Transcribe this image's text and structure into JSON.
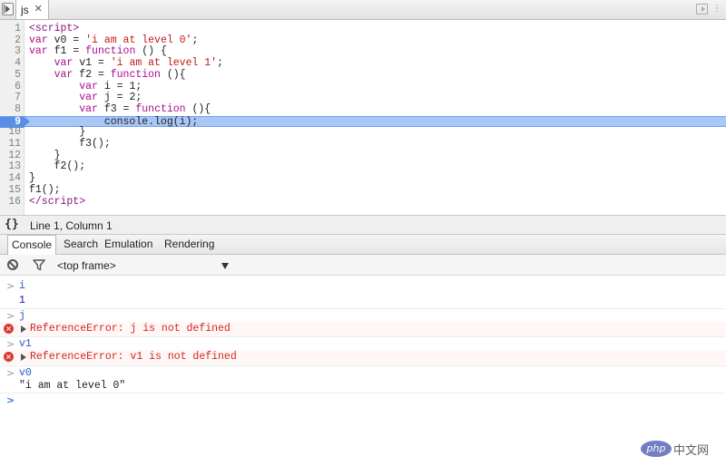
{
  "sources": {
    "tab": {
      "label": "js",
      "close_glyph": "✕"
    },
    "more_glyph": "⋮",
    "lines": [
      {
        "n": "1",
        "html": "<span class=\"t\">&lt;script&gt;</span>"
      },
      {
        "n": "2",
        "html": "<span class=\"k\">var</span> v0 = <span class=\"s\">'i am at level 0'</span>;"
      },
      {
        "n": "3",
        "html": "<span class=\"k\">var</span> f1 = <span class=\"k\">function</span> () {"
      },
      {
        "n": "4",
        "html": "    <span class=\"k\">var</span> v1 = <span class=\"s\">'i am at level 1'</span>;"
      },
      {
        "n": "5",
        "html": "    <span class=\"k\">var</span> f2 = <span class=\"k\">function</span> (){"
      },
      {
        "n": "6",
        "html": "        <span class=\"k\">var</span> i = 1;"
      },
      {
        "n": "7",
        "html": "        <span class=\"k\">var</span> j = 2;"
      },
      {
        "n": "8",
        "html": "        <span class=\"k\">var</span> f3 = <span class=\"k\">function</span> (){"
      },
      {
        "n": "9",
        "html": "            console.log(i);",
        "highlight": true
      },
      {
        "n": "10",
        "html": "        }"
      },
      {
        "n": "11",
        "html": "        f3();"
      },
      {
        "n": "12",
        "html": "    }"
      },
      {
        "n": "13",
        "html": "    f2();"
      },
      {
        "n": "14",
        "html": "}"
      },
      {
        "n": "15",
        "html": "f1();"
      },
      {
        "n": "16",
        "html": "<span class=\"t\">&lt;/script&gt;</span>"
      }
    ]
  },
  "status": {
    "braces_glyph": "{}",
    "cursor_position": "Line 1, Column 1"
  },
  "drawer": {
    "tabs": [
      "Console",
      "Search",
      "Emulation",
      "Rendering"
    ],
    "active_tab": "Console"
  },
  "console_toolbar": {
    "frame": "<top frame>"
  },
  "console": {
    "messages": [
      {
        "kind": "command",
        "text": "i"
      },
      {
        "kind": "result",
        "text": "1"
      },
      {
        "kind": "command",
        "text": "j"
      },
      {
        "kind": "error",
        "text": "ReferenceError: j is not defined"
      },
      {
        "kind": "command",
        "text": "v1"
      },
      {
        "kind": "error",
        "text": "ReferenceError: v1 is not defined"
      },
      {
        "kind": "command",
        "text": "v0"
      },
      {
        "kind": "string",
        "text": "\"i am at level 0\""
      },
      {
        "kind": "prompt",
        "text": ""
      }
    ],
    "caret_glyph": ">",
    "error_glyph": "×"
  },
  "watermark": {
    "logo": "php",
    "text": "中文网"
  },
  "colors": {
    "highlight_line": "#a8c7f7",
    "error_red": "#d2281e",
    "command_blue": "#2a56c7"
  }
}
